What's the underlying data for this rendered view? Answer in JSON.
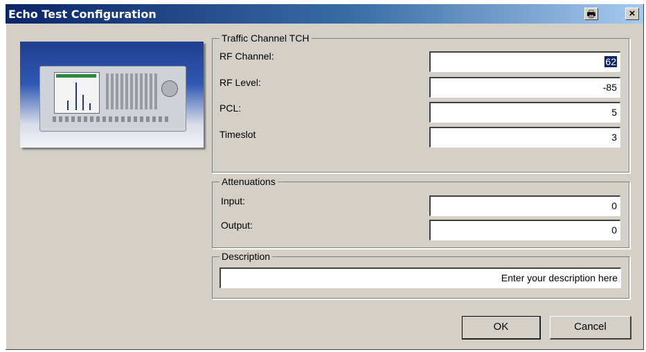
{
  "window": {
    "title": "Echo Test Configuration",
    "print_icon": "printer-icon",
    "close_label": "×"
  },
  "traffic_channel": {
    "legend": "Traffic Channel TCH",
    "rf_channel_label": "RF Channel:",
    "rf_channel_value": "62",
    "rf_level_label": "RF Level:",
    "rf_level_value": "-85",
    "pcl_label": "PCL:",
    "pcl_value": "5",
    "timeslot_label": "Timeslot",
    "timeslot_value": "3"
  },
  "attenuations": {
    "legend": "Attenuations",
    "input_label": "Input:",
    "input_value": "0",
    "output_label": "Output:",
    "output_value": "0"
  },
  "description": {
    "legend": "Description",
    "value": "Enter your description here"
  },
  "buttons": {
    "ok_label": "OK",
    "cancel_label": "Cancel"
  },
  "colors": {
    "title_bar": "#0a246a",
    "dialog_face": "#d4d0c8",
    "selection": "#0a246a"
  }
}
